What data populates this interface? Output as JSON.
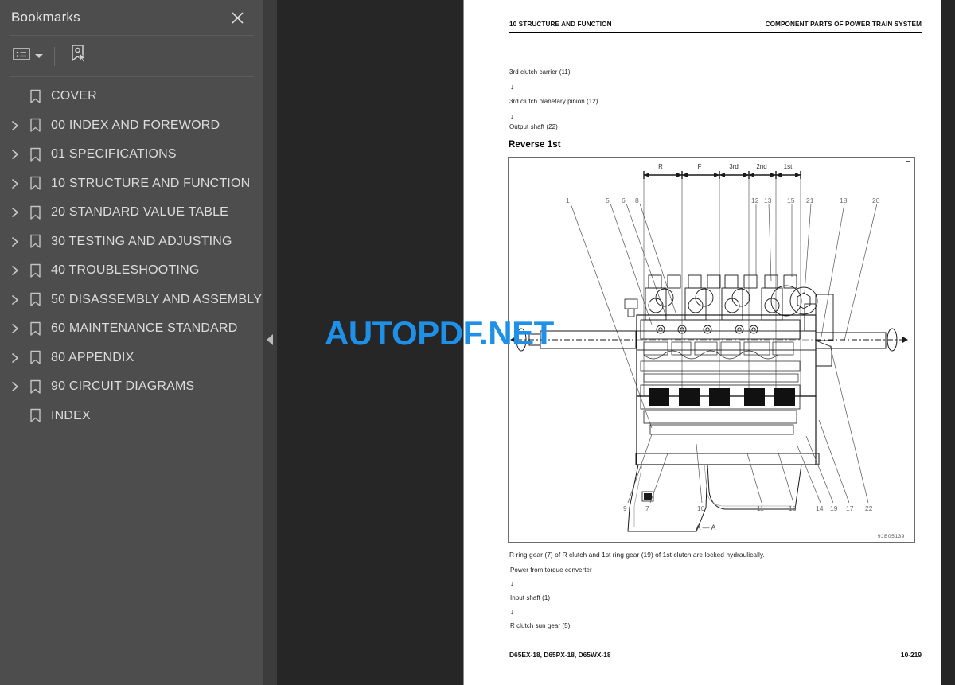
{
  "sidebar": {
    "title": "Bookmarks",
    "close_icon": "close-icon",
    "toolbar": {
      "options_label": "list-options-icon",
      "options_caret": "chevron-down-icon",
      "new_bookmark_label": "new-bookmark-icon"
    },
    "items": [
      {
        "label": "COVER",
        "expandable": false
      },
      {
        "label": "00 INDEX AND FOREWORD",
        "expandable": true
      },
      {
        "label": "01 SPECIFICATIONS",
        "expandable": true
      },
      {
        "label": "10 STRUCTURE AND FUNCTION",
        "expandable": true
      },
      {
        "label": "20 STANDARD VALUE TABLE",
        "expandable": true
      },
      {
        "label": "30 TESTING AND ADJUSTING",
        "expandable": true
      },
      {
        "label": "40 TROUBLESHOOTING",
        "expandable": true
      },
      {
        "label": "50 DISASSEMBLY AND ASSEMBLY",
        "expandable": true
      },
      {
        "label": "60 MAINTENANCE STANDARD",
        "expandable": true
      },
      {
        "label": "80 APPENDIX",
        "expandable": true
      },
      {
        "label": "90 CIRCUIT DIAGRAMS",
        "expandable": true
      },
      {
        "label": "INDEX",
        "expandable": false
      }
    ],
    "collapse_handle": "collapse-sidebar-icon"
  },
  "watermark": {
    "text": "AUTOPDF.NET",
    "color": "#1f90e8"
  },
  "page": {
    "header_left": "10 STRUCTURE AND FUNCTION",
    "header_right": "COMPONENT PARTS OF POWER TRAIN SYSTEM",
    "flow_top": [
      "3rd clutch carrier (11)",
      "↓",
      "3rd clutch planetary pinion (12)",
      "↓",
      "Output shaft (22)"
    ],
    "section_heading": "Reverse 1st",
    "figure": {
      "range_labels": [
        "R",
        "F",
        "3rd",
        "2nd",
        "1st"
      ],
      "callouts_top": [
        "1",
        "5",
        "6",
        "8",
        "12",
        "13",
        "15",
        "21",
        "18",
        "20"
      ],
      "callouts_bottom": [
        "9",
        "7",
        "10",
        "11",
        "16",
        "14",
        "19",
        "17",
        "22"
      ],
      "section_label": "A — A",
      "drawing_number": "9JB05139"
    },
    "caption": "R ring gear (7) of R clutch and 1st ring gear (19) of 1st clutch are locked hydraulically.",
    "flow_bottom": [
      "Power from torque converter",
      "↓",
      "Input shaft (1)",
      "↓",
      "R clutch sun gear (5)"
    ],
    "footer_left": "D65EX-18, D65PX-18, D65WX-18",
    "footer_right": "10-219"
  }
}
